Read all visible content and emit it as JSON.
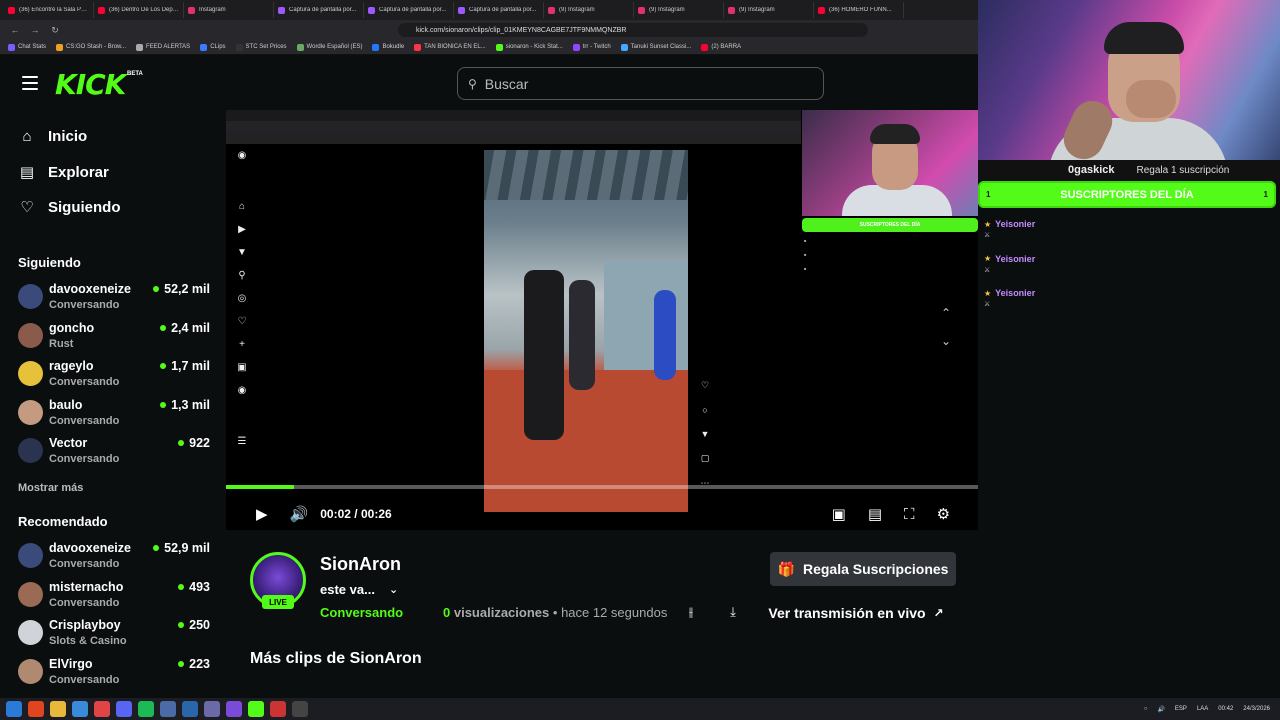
{
  "browser": {
    "tabs": [
      {
        "label": "(36) Encontré la Sala Pe...",
        "color": "#ff0033"
      },
      {
        "label": "(36) Dentro De Los Depó...",
        "color": "#ff0033"
      },
      {
        "label": "Instagram",
        "color": "#e1306c"
      },
      {
        "label": "Captura de pantalla por...",
        "color": "#9b59ff"
      },
      {
        "label": "Captura de pantalla por...",
        "color": "#9b59ff"
      },
      {
        "label": "Captura de pantalla por...",
        "color": "#9b59ff"
      },
      {
        "label": "(9) Instagram",
        "color": "#e1306c"
      },
      {
        "label": "(9) Instagram",
        "color": "#e1306c"
      },
      {
        "label": "(9) Instagram",
        "color": "#e1306c"
      },
      {
        "label": "(36) HOMERO FUNN...",
        "color": "#ff0033"
      }
    ],
    "url": "kick.com/sionaron/clips/clip_01KMEYN8CAGBE7JTF9NMMQNZBR",
    "bookmarks": [
      {
        "label": "Chat Stats",
        "color": "#7c5cff"
      },
      {
        "label": "CS:GO Stash - Brow...",
        "color": "#f0a020"
      },
      {
        "label": "FEED ALERTAS",
        "color": "#aaaaaa"
      },
      {
        "label": "CLips",
        "color": "#3a7bff"
      },
      {
        "label": "STC Set Prices",
        "color": "#333333"
      },
      {
        "label": "Wordle Español (ES)",
        "color": "#6aaa64"
      },
      {
        "label": "Bokudle",
        "color": "#2277ff"
      },
      {
        "label": "TAN BIONICA EN EL...",
        "color": "#ff3344"
      },
      {
        "label": "sionaron - Kick Stat...",
        "color": "#53fc18"
      },
      {
        "label": "trr - Twitch",
        "color": "#9146ff"
      },
      {
        "label": "Tanuki Sunset Classi...",
        "color": "#44aaff"
      },
      {
        "label": "(2) BARRA",
        "color": "#ff0033"
      }
    ]
  },
  "header": {
    "logo": "KICK",
    "beta": "BETA",
    "search_placeholder": "Buscar"
  },
  "sidebar": {
    "nav": [
      {
        "label": "Inicio",
        "icon": "home-icon"
      },
      {
        "label": "Explorar",
        "icon": "browse-icon"
      },
      {
        "label": "Siguiendo",
        "icon": "heart-icon"
      }
    ],
    "following_title": "Siguiendo",
    "following": [
      {
        "name": "davooxeneize",
        "sub": "Conversando",
        "viewers": "52,2 mil",
        "color": "#3a4a7a"
      },
      {
        "name": "goncho",
        "sub": "Rust",
        "viewers": "2,4 mil",
        "color": "#8a5a4a"
      },
      {
        "name": "rageylo",
        "sub": "Conversando",
        "viewers": "1,7 mil",
        "color": "#e6c13a"
      },
      {
        "name": "baulo",
        "sub": "Conversando",
        "viewers": "1,3 mil",
        "color": "#c49a80"
      },
      {
        "name": "Vector",
        "sub": "Conversando",
        "viewers": "922",
        "color": "#2a3450"
      }
    ],
    "show_more": "Mostrar más",
    "recommended_title": "Recomendado",
    "recommended": [
      {
        "name": "davooxeneize",
        "sub": "Conversando",
        "viewers": "52,9 mil",
        "color": "#3a4a7a"
      },
      {
        "name": "misternacho",
        "sub": "Conversando",
        "viewers": "493",
        "color": "#9a6a55"
      },
      {
        "name": "Crisplayboy",
        "sub": "Slots & Casino",
        "viewers": "250",
        "color": "#d0d4da"
      },
      {
        "name": "ElVirgo",
        "sub": "Conversando",
        "viewers": "223",
        "color": "#b08a70"
      }
    ]
  },
  "player": {
    "current_time": "00:02",
    "separator": "/",
    "duration": "00:26",
    "progress": 0.09
  },
  "overlay": {
    "sub_top_name": "0gaskick",
    "sub_gift_text": "Regala 1 suscripción",
    "subs_title": "SUSCRIPTORES DEL DÍA",
    "sub_rank_left": "1",
    "sub_rank_right": "1",
    "rows": [
      "Yeisonier",
      "Yeisonier",
      "Yeisonier"
    ]
  },
  "clip": {
    "channel": "SionAron",
    "title": "este va...",
    "live_badge": "LIVE",
    "category": "Conversando",
    "views_count": "0",
    "views_label": "visualizaciones",
    "dot": "•",
    "time_ago": "hace 12 segundos",
    "gift_button": "Regala Suscripciones",
    "watch_live_button": "Ver transmisión en vivo",
    "more_clips_title": "Más clips de SionAron"
  },
  "taskbar": {
    "lang": "ESP",
    "region": "LAA",
    "time": "00:42",
    "date": "24/3/2026"
  }
}
